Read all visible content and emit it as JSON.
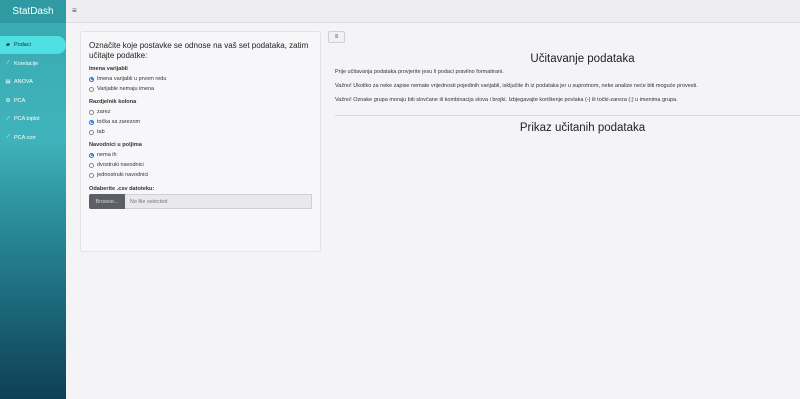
{
  "sidebar": {
    "brand": "StatDash",
    "items": [
      {
        "label": "Podaci",
        "icon": "folder-open-icon",
        "glyph": "▰"
      },
      {
        "label": "Korelacije",
        "icon": "line-chart-icon",
        "glyph": "⟋"
      },
      {
        "label": "ANOVA",
        "icon": "table-icon",
        "glyph": "▤"
      },
      {
        "label": "PCA",
        "icon": "gear-icon",
        "glyph": "⚙"
      },
      {
        "label": "PCA biplot",
        "icon": "line-chart-icon",
        "glyph": "⟋"
      },
      {
        "label": "PCA corr",
        "icon": "line-chart-icon",
        "glyph": "⟋"
      }
    ]
  },
  "topbar": {
    "toggle": "≡"
  },
  "panel": {
    "title": "Označite koje postavke se odnose na vaš set podataka, zatim učitajte podatke:",
    "header_group": {
      "label": "Imena varijabli",
      "options": [
        "Imena varijabli u prvom redu",
        "Varijable nemaju imena"
      ],
      "selected": 0
    },
    "sep_group": {
      "label": "Razdjelnik kolona",
      "options": [
        "zarez",
        "točka sa zarezom",
        "tab"
      ],
      "selected": 1
    },
    "quote_group": {
      "label": "Navodnici u poljima",
      "options": [
        "nema ih",
        "dvostruki navodnici",
        "jednostruki navodnici"
      ],
      "selected": 0
    },
    "file": {
      "label": "Odaberite .csv datoteku:",
      "button": "Browse...",
      "placeholder": "No file selected"
    }
  },
  "main": {
    "menu_button": "≡",
    "title": "Učitavanje podataka",
    "paragraphs": [
      "Prije učitavanja podataka provjerite jesu li podaci pravilno formatirani.",
      "Važno! Ukoliko za neke zapise nemate vrijednosti pojedinih varijabli, isključite ih iz podataka jer u suprotnom, neke analize neće biti moguće provesti.",
      "Važno! Oznake grupa moraju biti slovčane ili kombinacija slova i brojki. Izbjegavajte korištenje povlaka (-) ili točki-zareza (;) u imenima grupa."
    ],
    "subtitle": "Prikaz učitanih podataka"
  }
}
